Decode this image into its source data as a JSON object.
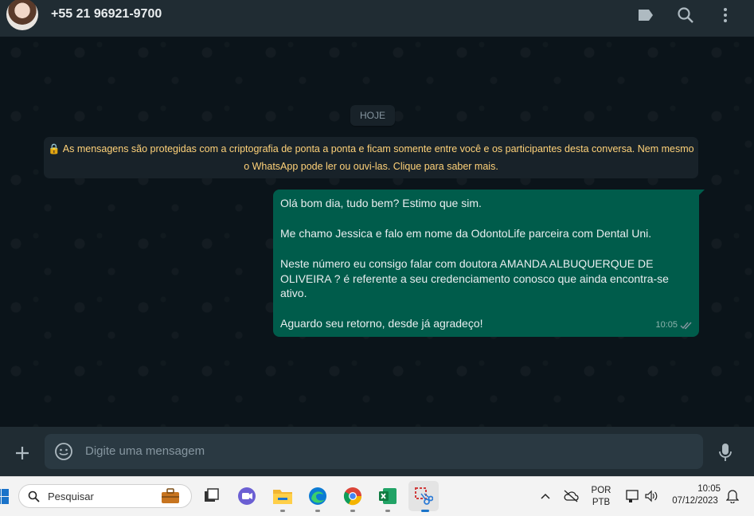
{
  "header": {
    "contact_name": "+55 21 96921-9700",
    "icons": [
      "label-icon",
      "search-icon",
      "menu-icon"
    ]
  },
  "chat": {
    "date_chip": "HOJE",
    "encryption_notice_line1": "🔒 As mensagens são protegidas com a criptografia de ponta a ponta e ficam somente entre você e os participantes desta conversa. Nem mesmo",
    "encryption_notice_line2": "o WhatsApp pode ler ou ouvi-las. Clique para saber mais.",
    "message": {
      "line1": "Olá bom dia, tudo bem? Estimo que sim.",
      "line2": "Me chamo Jessica e falo em nome da OdontoLife parceira com Dental Uni.",
      "line3": "Neste número eu consigo falar com doutora AMANDA ALBUQUERQUE DE",
      "line4": "OLIVEIRA ? é referente a seu credenciamento conosco que ainda encontra-se",
      "line5": "ativo.",
      "line6": "Aguardo seu retorno, desde já agradeço!",
      "time": "10:05",
      "status": "read"
    }
  },
  "composer": {
    "placeholder": "Digite uma mensagem"
  },
  "taskbar": {
    "search_placeholder": "Pesquisar",
    "lang_top": "POR",
    "lang_bottom": "PTB",
    "time": "10:05",
    "date": "07/12/2023"
  },
  "colors": {
    "header_bg": "#202c33",
    "chat_bg": "#0b141a",
    "outgoing_bubble": "#005c4b",
    "notice_text": "#ffd279",
    "read_tick": "#8696a0"
  }
}
